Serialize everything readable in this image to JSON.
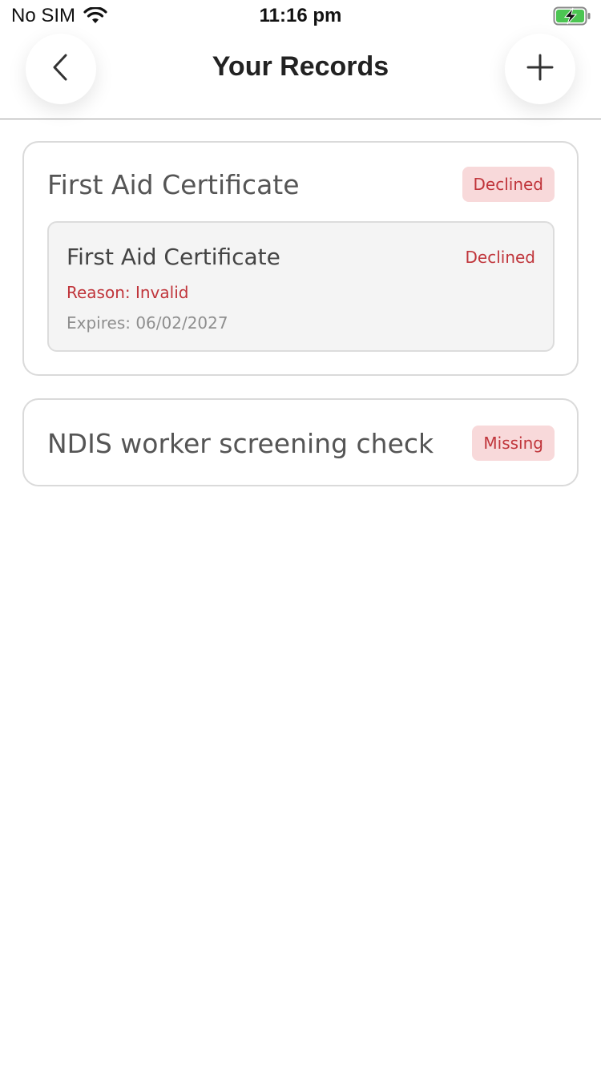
{
  "status_bar": {
    "carrier": "No SIM",
    "time": "11:16 pm",
    "battery_color": "#4cc552"
  },
  "nav": {
    "title": "Your Records",
    "back_icon": "chevron-left-icon",
    "add_icon": "plus-icon"
  },
  "colors": {
    "accent_red": "#c0353b",
    "badge_bg": "#f8d9da",
    "card_border": "#dadada"
  },
  "records": [
    {
      "title": "First Aid Certificate",
      "badge": "Declined",
      "entry": {
        "title": "First Aid Certificate",
        "status": "Declined",
        "reason": "Reason: Invalid",
        "expires": "Expires: 06/02/2027"
      }
    },
    {
      "title": "NDIS worker screening check",
      "badge": "Missing"
    }
  ]
}
